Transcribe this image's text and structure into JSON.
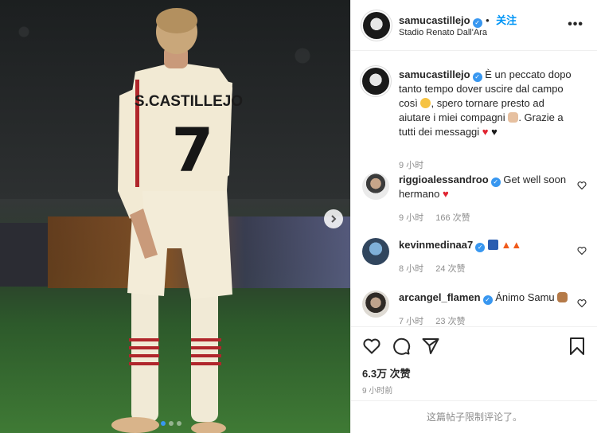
{
  "post": {
    "author": "samucastillejo",
    "follow_label": "关注",
    "location": "Stadio Renato Dall'Ara",
    "more_label": "•••",
    "jersey_name": "S.CASTILLEJO",
    "jersey_number": "7",
    "caption_text_1": "È un peccato dopo tanto tempo dover uscire dal campo così",
    "caption_text_2": ", spero tornare presto ad aiutare i miei compagni",
    "caption_text_3": ". Grazie a tutti dei messaggi",
    "caption_time": "9 小时",
    "likes": "6.3万 次赞",
    "post_time": "9 小时前",
    "comments_limited": "这篇帖子限制评论了。",
    "carousel_current": 1,
    "carousel_total": 3
  },
  "comments": [
    {
      "user": "riggioalessandroo",
      "text": "Get well soon hermano",
      "time": "9 小时",
      "likes": "166 次赞"
    },
    {
      "user": "kevinmedinaa7",
      "text": "",
      "time": "8 小时",
      "likes": "24 次赞"
    },
    {
      "user": "arcangel_flamen",
      "text": "Ánimo Samu",
      "time": "7 小时",
      "likes": "23 次赞"
    }
  ],
  "colors": {
    "accent": "#0095f6",
    "verified": "#3897f0",
    "heart_red": "#ed4956"
  }
}
